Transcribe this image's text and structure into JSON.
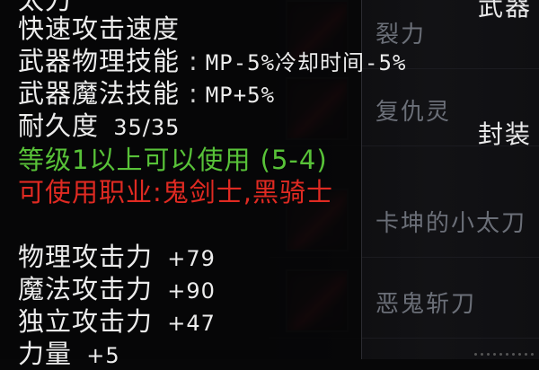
{
  "tooltip": {
    "title_partial": "太刀",
    "lines": [
      {
        "label": "快速攻击速度",
        "value": ""
      },
      {
        "label": "武器物理技能",
        "value": "MP-5%冷却时间-5%"
      },
      {
        "label": "武器魔法技能",
        "value": "MP+5%"
      },
      {
        "label": "耐久度",
        "value": "35/35"
      }
    ],
    "level_req": "等级1以上可以使用 (5-4)",
    "class_req": "可使用职业:鬼剑士,黑骑士",
    "stats": [
      {
        "label": "物理攻击力",
        "value": "+79"
      },
      {
        "label": "魔法攻击力",
        "value": "+90"
      },
      {
        "label": "独立攻击力",
        "value": "+47"
      },
      {
        "label": "力量",
        "value": "+5"
      }
    ],
    "colors": {
      "text": "#ececec",
      "level_req": "#58c238",
      "class_req": "#e02a22"
    }
  },
  "background_list": {
    "corner_label": "武器",
    "seal_label": "封装",
    "items": [
      {
        "name": "裂力"
      },
      {
        "name": "复仇灵"
      },
      {
        "name": "卡坤的小太刀"
      },
      {
        "name": "恶鬼斩刀"
      }
    ]
  }
}
